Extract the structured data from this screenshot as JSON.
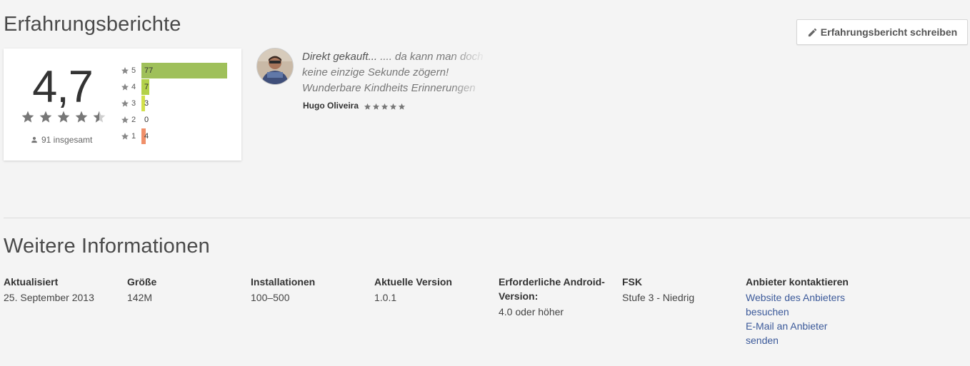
{
  "reviews": {
    "title": "Erfahrungsberichte",
    "write_button_label": "Erfahrungsbericht schreiben",
    "score": "4,7",
    "rating_value": 4.7,
    "total_label": "91 insgesamt",
    "histogram": [
      {
        "stars": "5",
        "count": "77",
        "color": "#9fc05a"
      },
      {
        "stars": "4",
        "count": "7",
        "color": "#b3d149"
      },
      {
        "stars": "3",
        "count": "3",
        "color": "#d2e04b"
      },
      {
        "stars": "2",
        "count": "0",
        "color": "#f5c253"
      },
      {
        "stars": "1",
        "count": "4",
        "color": "#f0906a"
      }
    ],
    "review_item": {
      "title": "Direkt gekauft...",
      "body": " .... da kann man doch keine einzige Sekunde zögern! Wunderbare Kindheits Erinnerungen sind ua mit",
      "author": "Hugo Oliveira",
      "rating": 5
    }
  },
  "info": {
    "title": "Weitere Informationen",
    "columns": [
      {
        "label": "Aktualisiert",
        "value": "25. September 2013"
      },
      {
        "label": "Größe",
        "value": "142M"
      },
      {
        "label": "Installationen",
        "value": "100–500"
      },
      {
        "label": "Aktuelle Version",
        "value": "1.0.1"
      },
      {
        "label": "Erforderliche Android-Version:",
        "value": "4.0 oder höher"
      },
      {
        "label": "FSK",
        "value": "Stufe 3 - Niedrig"
      }
    ],
    "contact": {
      "label": "Anbieter kontaktieren",
      "links": [
        "Website des Anbieters besuchen",
        "E-Mail an Anbieter senden"
      ]
    }
  },
  "colors": {
    "star_grey": "#777777",
    "link_blue": "#3c5a9a",
    "background": "#f4f4f4"
  }
}
